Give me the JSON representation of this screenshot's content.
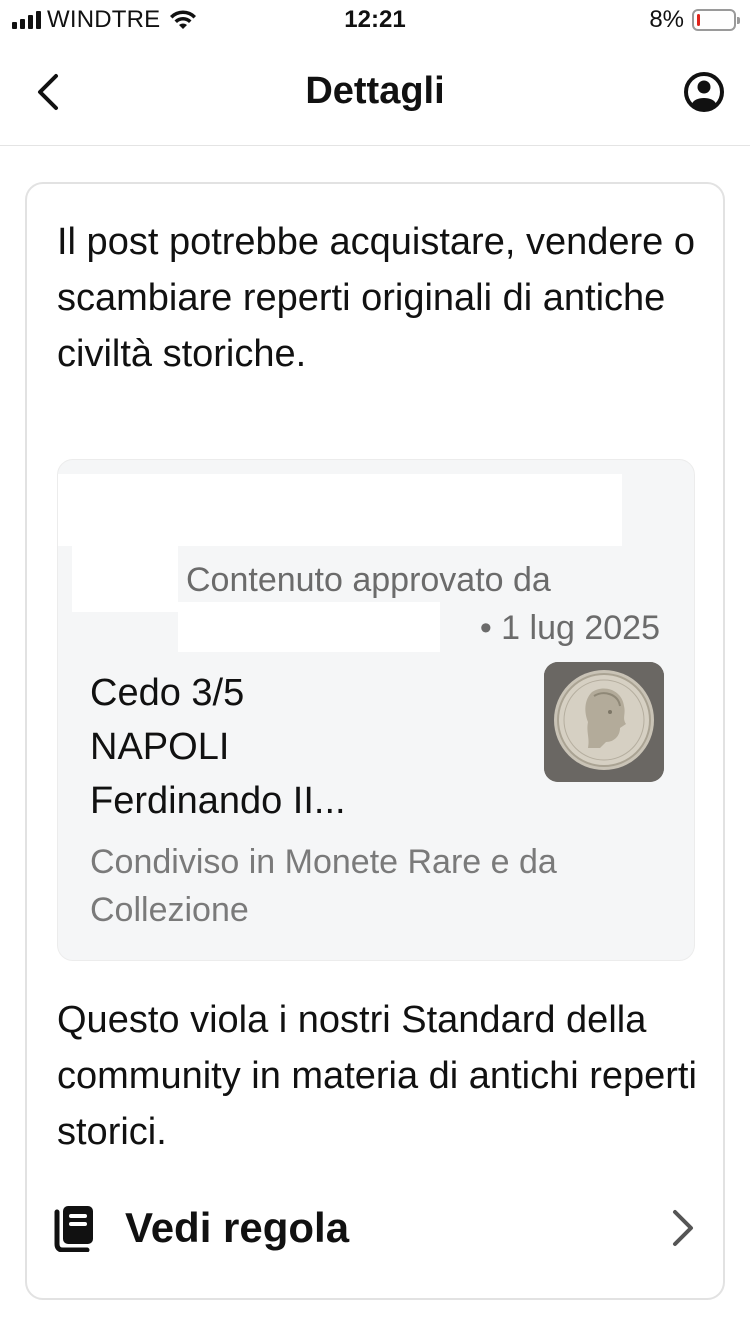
{
  "status_bar": {
    "carrier": "WINDTRE",
    "time": "12:21",
    "battery_percent_label": "8%",
    "battery_level": 0.08,
    "battery_color": "#e0241b"
  },
  "nav": {
    "title": "Dettagli",
    "back_icon": "chevron-left-icon",
    "account_icon": "user-circle-icon"
  },
  "card": {
    "intro": "Il post potrebbe acquistare, vendere o scambiare reperti originali di antiche civiltà storiche.",
    "post": {
      "approved_label": "Contenuto approvato da",
      "date": "• 1 lug 2025",
      "title_lines": [
        "Cedo 3/5",
        "NAPOLI",
        "Ferdinando II..."
      ],
      "shared_in": "Condiviso in Monete Rare e da Collezione",
      "thumbnail": "coin-photo"
    },
    "violation": "Questo viola i nostri Standard della community in materia di antichi reperti storici.",
    "rule_link": {
      "label": "Vedi regola",
      "icon": "book-icon",
      "chevron_icon": "chevron-right-icon"
    }
  }
}
